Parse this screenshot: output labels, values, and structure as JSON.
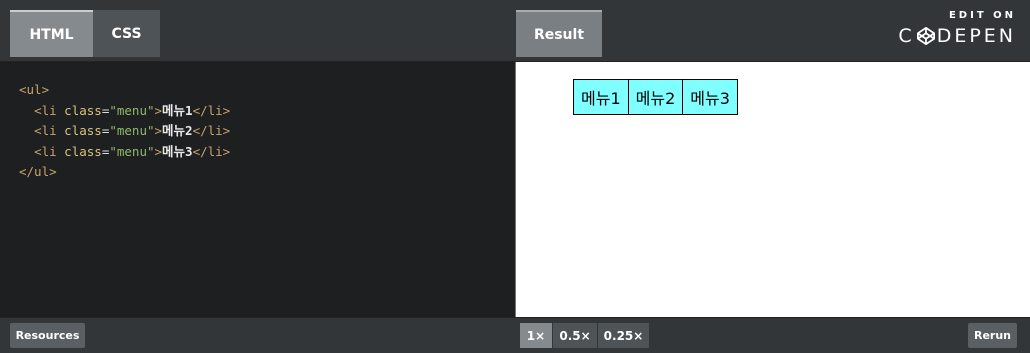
{
  "tabs": {
    "html": "HTML",
    "css": "CSS",
    "result": "Result"
  },
  "brand": {
    "top": "EDIT ON",
    "left": "C",
    "right": "DEPEN",
    "icon": "codepen-logo-icon"
  },
  "code": {
    "lines": [
      {
        "open": "<ul>"
      },
      {
        "indent": "  ",
        "tag_open": "<li",
        "attr": "class",
        "eq": "=",
        "value": "\"menu\"",
        "close_bracket": ">",
        "text": "메뉴1",
        "tag_close": "</li>"
      },
      {
        "indent": "  ",
        "tag_open": "<li",
        "attr": "class",
        "eq": "=",
        "value": "\"menu\"",
        "close_bracket": ">",
        "text": "메뉴2",
        "tag_close": "</li>"
      },
      {
        "indent": "  ",
        "tag_open": "<li",
        "attr": "class",
        "eq": "=",
        "value": "\"menu\"",
        "close_bracket": ">",
        "text": "메뉴3",
        "tag_close": "</li>"
      },
      {
        "open": "</ul>"
      }
    ]
  },
  "result": {
    "menu_items": [
      "메뉴1",
      "메뉴2",
      "메뉴3"
    ],
    "menu_bg": "#7fffff"
  },
  "bottom": {
    "resources": "Resources",
    "zoom": [
      "1×",
      "0.5×",
      "0.25×"
    ],
    "zoom_selected": "1×",
    "rerun": "Rerun"
  },
  "colors": {
    "bar": "#333639",
    "editor_bg": "#1d1f20",
    "tag": "#c8a26b",
    "attr": "#d9c37d",
    "string": "#8fb86b"
  }
}
